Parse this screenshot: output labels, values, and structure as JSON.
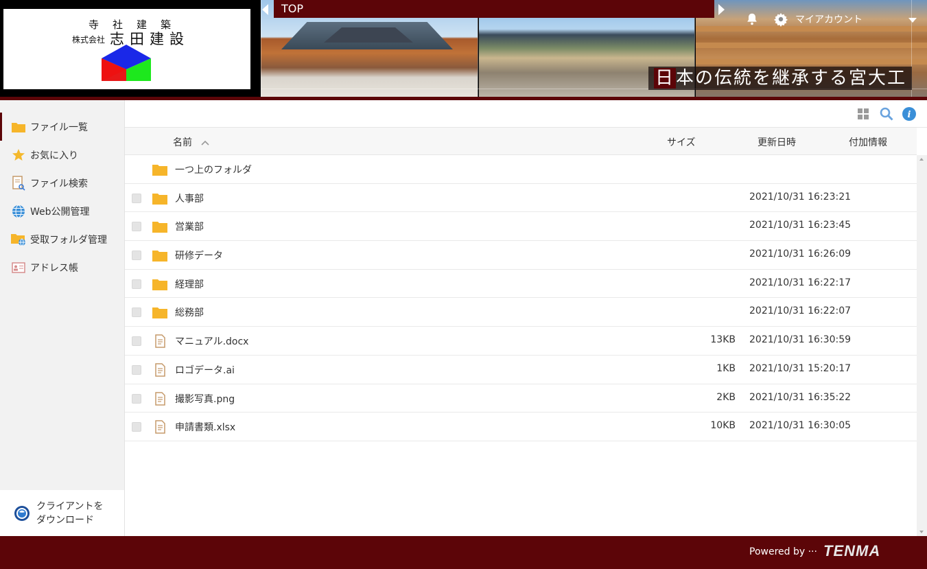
{
  "header": {
    "logo": {
      "subtitle": "寺社建築",
      "corp_prefix": "株式会社",
      "company_name": "志田建設"
    },
    "tagline": "日本の伝統を継承する宮大工",
    "top_tab_label": "TOP",
    "account_label": "マイアカウント",
    "colors": {
      "accent": "#5c0508"
    }
  },
  "sidebar": {
    "items": [
      {
        "label": "ファイル一覧",
        "icon": "folder-icon",
        "active": true
      },
      {
        "label": "お気に入り",
        "icon": "star-icon"
      },
      {
        "label": "ファイル検索",
        "icon": "file-search-icon"
      },
      {
        "label": "Web公開管理",
        "icon": "globe-icon"
      },
      {
        "label": "受取フォルダ管理",
        "icon": "receive-folder-icon"
      },
      {
        "label": "アドレス帳",
        "icon": "address-book-icon"
      }
    ],
    "client_download": {
      "line1": "クライアントを",
      "line2": "ダウンロード"
    }
  },
  "list": {
    "columns": {
      "name": "名前",
      "size": "サイズ",
      "updated": "更新日時",
      "extra": "付加情報"
    },
    "sort_indicator": "ascending",
    "parent_folder": "一つ上のフォルダ",
    "rows": [
      {
        "type": "folder",
        "name": "人事部",
        "size": "",
        "updated": "2021/10/31 16:23:21"
      },
      {
        "type": "folder",
        "name": "営業部",
        "size": "",
        "updated": "2021/10/31 16:23:45"
      },
      {
        "type": "folder",
        "name": "研修データ",
        "size": "",
        "updated": "2021/10/31 16:26:09"
      },
      {
        "type": "folder",
        "name": "経理部",
        "size": "",
        "updated": "2021/10/31 16:22:17"
      },
      {
        "type": "folder",
        "name": "総務部",
        "size": "",
        "updated": "2021/10/31 16:22:07"
      },
      {
        "type": "file",
        "name": "マニュアル.docx",
        "size": "13KB",
        "updated": "2021/10/31 16:30:59"
      },
      {
        "type": "file",
        "name": "ロゴデータ.ai",
        "size": "1KB",
        "updated": "2021/10/31 15:20:17"
      },
      {
        "type": "file",
        "name": "撮影写真.png",
        "size": "2KB",
        "updated": "2021/10/31 16:35:22"
      },
      {
        "type": "file",
        "name": "申請書類.xlsx",
        "size": "10KB",
        "updated": "2021/10/31 16:30:05"
      }
    ]
  },
  "footer": {
    "powered_by": "Powered by ···",
    "brand": "TENMA"
  }
}
